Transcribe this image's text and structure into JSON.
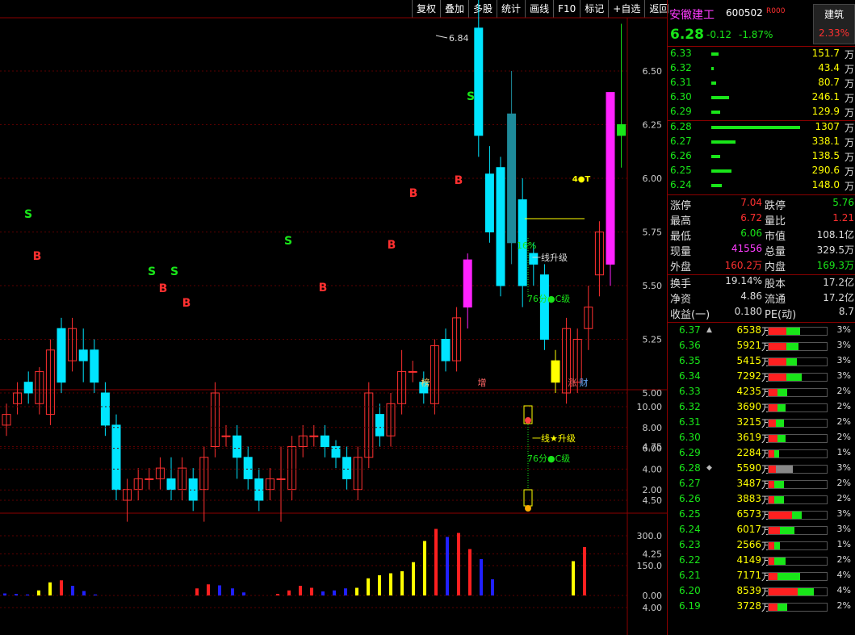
{
  "toolbar": {
    "items": [
      "复权",
      "叠加",
      "多股",
      "统计",
      "画线",
      "F10",
      "标记",
      "+自选",
      "返回"
    ]
  },
  "stock": {
    "name": "安徽建工",
    "code": "600502",
    "tag": "R000",
    "price": "6.28",
    "change": "-0.12",
    "change_pct": "-1.87%",
    "industry": "建筑",
    "industry_pct": "2.33%"
  },
  "orderbook": {
    "asks": [
      {
        "p": "6.33",
        "v": "151.7",
        "w": 0.08
      },
      {
        "p": "6.32",
        "v": "43.4",
        "w": 0.03
      },
      {
        "p": "6.31",
        "v": "80.7",
        "w": 0.05
      },
      {
        "p": "6.30",
        "v": "246.1",
        "w": 0.2
      },
      {
        "p": "6.29",
        "v": "129.9",
        "w": 0.1
      }
    ],
    "bids": [
      {
        "p": "6.28",
        "v": "1307",
        "w": 1.0
      },
      {
        "p": "6.27",
        "v": "338.1",
        "w": 0.27
      },
      {
        "p": "6.26",
        "v": "138.5",
        "w": 0.1
      },
      {
        "p": "6.25",
        "v": "290.6",
        "w": 0.23
      },
      {
        "p": "6.24",
        "v": "148.0",
        "w": 0.12
      }
    ],
    "unit": "万"
  },
  "stats": [
    {
      "l1": "涨停",
      "v1": "7.04",
      "c1": "#ff3030",
      "l2": "跌停",
      "v2": "5.76",
      "c2": "#19e619"
    },
    {
      "l1": "最高",
      "v1": "6.72",
      "c1": "#ff3030",
      "l2": "量比",
      "v2": "1.21",
      "c2": "#ff3030"
    },
    {
      "l1": "最低",
      "v1": "6.06",
      "c1": "#19e619",
      "l2": "市值",
      "v2": "108.1亿",
      "c2": "#ddd"
    },
    {
      "l1": "现量",
      "v1": "41556",
      "c1": "#ff3cff",
      "l2": "总量",
      "v2": "329.5万",
      "c2": "#ddd"
    },
    {
      "l1": "外盘",
      "v1": "160.2万",
      "c1": "#ff3030",
      "l2": "内盘",
      "v2": "169.3万",
      "c2": "#19e619"
    },
    {
      "l1": "换手",
      "v1": "19.14%",
      "c1": "#ddd",
      "l2": "股本",
      "v2": "17.2亿",
      "c2": "#ddd"
    },
    {
      "l1": "净资",
      "v1": "4.86",
      "c1": "#ddd",
      "l2": "流通",
      "v2": "17.2亿",
      "c2": "#ddd"
    },
    {
      "l1": "收益(一)",
      "v1": "0.180",
      "c1": "#ddd",
      "l2": "PE(动)",
      "v2": "8.7",
      "c2": "#ddd"
    }
  ],
  "vol_profile": [
    {
      "p": "6.37",
      "mark": "▲",
      "v": "6538",
      "r": 0.3,
      "g": 0.45,
      "pc": "3%"
    },
    {
      "p": "6.36",
      "mark": "",
      "v": "5921",
      "r": 0.3,
      "g": 0.4,
      "pc": "3%"
    },
    {
      "p": "6.35",
      "mark": "",
      "v": "5415",
      "r": 0.3,
      "g": 0.35,
      "pc": "3%"
    },
    {
      "p": "6.34",
      "mark": "",
      "v": "7292",
      "r": 0.3,
      "g": 0.5,
      "pc": "3%"
    },
    {
      "p": "6.33",
      "mark": "",
      "v": "4235",
      "r": 0.15,
      "g": 0.3,
      "pc": "2%"
    },
    {
      "p": "6.32",
      "mark": "",
      "v": "3690",
      "r": 0.15,
      "g": 0.25,
      "pc": "2%"
    },
    {
      "p": "6.31",
      "mark": "",
      "v": "3215",
      "r": 0.12,
      "g": 0.25,
      "pc": "2%"
    },
    {
      "p": "6.30",
      "mark": "",
      "v": "3619",
      "r": 0.15,
      "g": 0.25,
      "pc": "2%"
    },
    {
      "p": "6.29",
      "mark": "",
      "v": "2284",
      "r": 0.1,
      "g": 0.15,
      "pc": "1%"
    },
    {
      "p": "6.28",
      "mark": "◆",
      "v": "5590",
      "r": 0.12,
      "g": 0.55,
      "pc": "3%"
    },
    {
      "p": "6.27",
      "mark": "",
      "v": "3487",
      "r": 0.1,
      "g": 0.3,
      "pc": "2%"
    },
    {
      "p": "6.26",
      "mark": "",
      "v": "3883",
      "r": 0.1,
      "g": 0.3,
      "pc": "2%"
    },
    {
      "p": "6.25",
      "mark": "",
      "v": "6573",
      "r": 0.4,
      "g": 0.3,
      "pc": "3%"
    },
    {
      "p": "6.24",
      "mark": "",
      "v": "6017",
      "r": 0.2,
      "g": 0.45,
      "pc": "3%"
    },
    {
      "p": "6.23",
      "mark": "",
      "v": "2566",
      "r": 0.1,
      "g": 0.18,
      "pc": "1%"
    },
    {
      "p": "6.22",
      "mark": "",
      "v": "4149",
      "r": 0.1,
      "g": 0.35,
      "pc": "2%"
    },
    {
      "p": "6.21",
      "mark": "",
      "v": "7171",
      "r": 0.15,
      "g": 0.7,
      "pc": "4%"
    },
    {
      "p": "6.20",
      "mark": "",
      "v": "8539",
      "r": 0.5,
      "g": 0.5,
      "pc": "4%"
    },
    {
      "p": "6.19",
      "mark": "",
      "v": "3728",
      "r": 0.15,
      "g": 0.3,
      "pc": "2%"
    }
  ],
  "chart_data": {
    "type": "candlestick",
    "yticks": [
      "6.50",
      "6.25",
      "6.00",
      "5.75",
      "5.50",
      "5.25",
      "5.00",
      "4.75",
      "4.50",
      "4.25",
      "4.00"
    ],
    "high_label": "6.84",
    "ind_ticks": [
      "10.00",
      "8.00",
      "6.00",
      "4.00",
      "2.00"
    ],
    "vol_ticks": [
      "300.0",
      "150.0",
      "0.00"
    ],
    "candles": [
      [
        4.85,
        4.9,
        4.8,
        4.95
      ],
      [
        4.95,
        5.0,
        4.9,
        5.05
      ],
      [
        5.05,
        5.0,
        4.95,
        5.1
      ],
      [
        4.95,
        5.1,
        4.9,
        5.12
      ],
      [
        4.9,
        5.2,
        4.85,
        5.25
      ],
      [
        5.3,
        5.05,
        5.0,
        5.35
      ],
      [
        5.15,
        5.3,
        5.1,
        5.35
      ],
      [
        5.2,
        5.15,
        5.05,
        5.3
      ],
      [
        5.2,
        5.05,
        5.0,
        5.25
      ],
      [
        5.0,
        4.85,
        4.8,
        5.05
      ],
      [
        4.85,
        4.55,
        4.5,
        4.9
      ],
      [
        4.5,
        4.55,
        4.4,
        4.6
      ],
      [
        4.55,
        4.6,
        4.5,
        4.65
      ],
      [
        4.6,
        4.6,
        4.55,
        4.65
      ],
      [
        4.6,
        4.65,
        4.55,
        4.7
      ],
      [
        4.6,
        4.55,
        4.5,
        4.7
      ],
      [
        4.55,
        4.65,
        4.5,
        4.7
      ],
      [
        4.6,
        4.5,
        4.45,
        4.65
      ],
      [
        4.55,
        4.7,
        4.4,
        4.75
      ],
      [
        4.75,
        5.0,
        4.7,
        5.05
      ],
      [
        4.8,
        4.8,
        4.75,
        4.85
      ],
      [
        4.8,
        4.7,
        4.6,
        4.85
      ],
      [
        4.7,
        4.6,
        4.55,
        4.75
      ],
      [
        4.6,
        4.5,
        4.45,
        4.65
      ],
      [
        4.55,
        4.6,
        4.5,
        4.65
      ],
      [
        4.6,
        4.6,
        4.4,
        4.75
      ],
      [
        4.55,
        4.75,
        4.5,
        4.8
      ],
      [
        4.75,
        4.8,
        4.7,
        4.85
      ],
      [
        4.8,
        4.8,
        4.75,
        4.85
      ],
      [
        4.8,
        4.75,
        4.7,
        4.85
      ],
      [
        4.75,
        4.7,
        4.65,
        4.78
      ],
      [
        4.7,
        4.6,
        4.55,
        4.75
      ],
      [
        4.55,
        4.7,
        4.5,
        4.75
      ],
      [
        4.7,
        5.0,
        4.65,
        5.05
      ],
      [
        4.9,
        4.8,
        4.75,
        4.95
      ],
      [
        4.8,
        4.95,
        4.75,
        5.0
      ],
      [
        4.95,
        5.1,
        4.9,
        5.2
      ],
      [
        5.1,
        5.1,
        5.05,
        5.15
      ],
      [
        5.05,
        5.0,
        4.95,
        5.1
      ],
      [
        4.95,
        5.22,
        4.9,
        5.25
      ],
      [
        5.25,
        5.15,
        5.1,
        5.3
      ],
      [
        5.15,
        5.35,
        5.1,
        5.4
      ],
      [
        5.4,
        5.62,
        5.3,
        5.65
      ],
      [
        6.2,
        6.7,
        6.1,
        6.84
      ],
      [
        6.02,
        5.75,
        5.7,
        6.15
      ],
      [
        5.5,
        6.05,
        5.45,
        6.1
      ],
      [
        6.3,
        5.7,
        5.6,
        6.5
      ],
      [
        5.9,
        5.5,
        5.4,
        6.0
      ],
      [
        5.65,
        5.6,
        5.5,
        5.7
      ],
      [
        5.55,
        5.25,
        5.2,
        5.6
      ],
      [
        5.15,
        5.05,
        5.0,
        5.2
      ],
      [
        5.0,
        5.3,
        4.95,
        5.35
      ],
      [
        5.05,
        5.25,
        5.0,
        5.3
      ],
      [
        5.3,
        5.4,
        5.2,
        5.5
      ],
      [
        5.55,
        5.75,
        5.45,
        5.8
      ],
      [
        5.6,
        6.4,
        5.5,
        6.4
      ],
      [
        6.25,
        6.2,
        6.05,
        6.72
      ]
    ],
    "vol": [
      [
        10,
        "b"
      ],
      [
        8,
        "b"
      ],
      [
        5,
        "b"
      ],
      [
        25,
        "y"
      ],
      [
        65,
        "y"
      ],
      [
        75,
        "r"
      ],
      [
        48,
        "b"
      ],
      [
        22,
        "b"
      ],
      [
        5,
        "b"
      ],
      [
        0,
        "y"
      ],
      [
        0,
        "y"
      ],
      [
        0,
        "y"
      ],
      [
        0,
        "y"
      ],
      [
        0,
        "y"
      ],
      [
        0,
        "y"
      ],
      [
        0,
        "y"
      ],
      [
        0,
        "y"
      ],
      [
        35,
        "r"
      ],
      [
        55,
        "r"
      ],
      [
        50,
        "b"
      ],
      [
        35,
        "b"
      ],
      [
        15,
        "b"
      ],
      [
        0,
        "y"
      ],
      [
        0,
        "y"
      ],
      [
        8,
        "r"
      ],
      [
        25,
        "r"
      ],
      [
        48,
        "r"
      ],
      [
        38,
        "r"
      ],
      [
        20,
        "b"
      ],
      [
        25,
        "b"
      ],
      [
        35,
        "b"
      ],
      [
        38,
        "y"
      ],
      [
        85,
        "y"
      ],
      [
        100,
        "y"
      ],
      [
        110,
        "y"
      ],
      [
        120,
        "y"
      ],
      [
        165,
        "y"
      ],
      [
        270,
        "y"
      ],
      [
        330,
        "r"
      ],
      [
        290,
        "b"
      ],
      [
        310,
        "r"
      ],
      [
        230,
        "r"
      ],
      [
        180,
        "b"
      ],
      [
        80,
        "b"
      ],
      [
        170,
        "y"
      ],
      [
        240,
        "r"
      ]
    ],
    "markers": [
      "S",
      "B",
      "S",
      "S",
      "B",
      "S",
      "B",
      "B",
      "B",
      "S",
      "B",
      "B",
      "4●T"
    ],
    "badges": [
      "榜",
      "增",
      "涨",
      "财"
    ],
    "annotations": [
      "16%",
      "一线升级",
      "76分●C级",
      "一线★升级",
      "76分●C级"
    ]
  }
}
